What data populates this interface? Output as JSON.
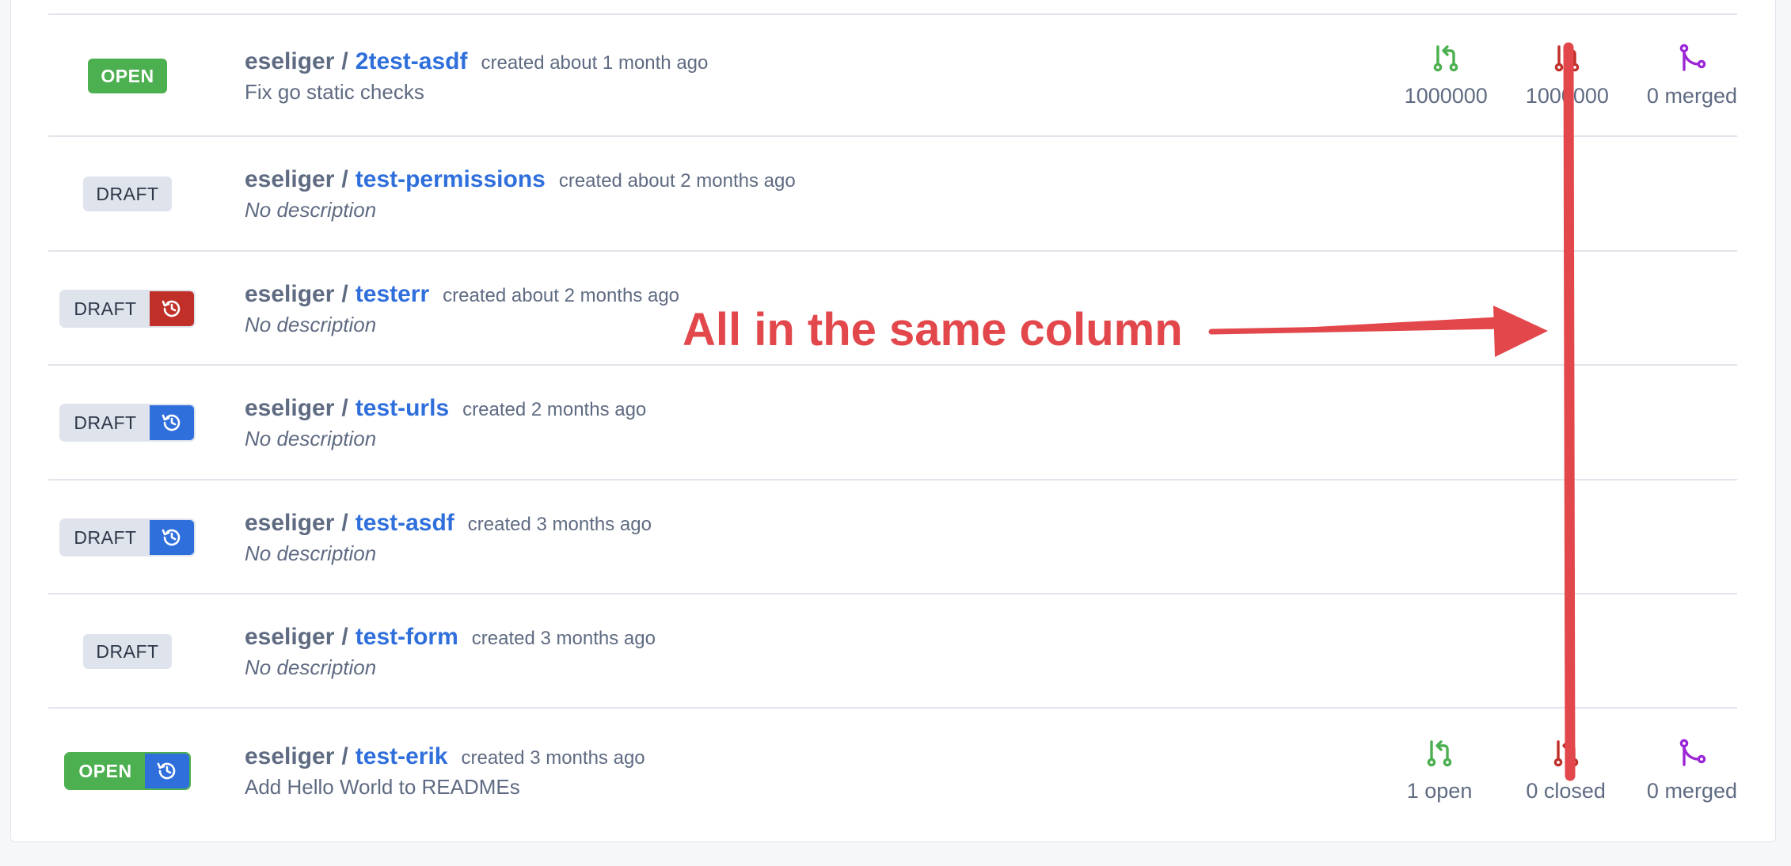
{
  "rows": [
    {
      "badge": "OPEN",
      "owner": "eseliger",
      "name": "2test-asdf",
      "created": "created about 1 month ago",
      "description": "Fix go static checks",
      "stats": {
        "open": "1000000",
        "closed": "1000000",
        "merged": "0 merged"
      }
    },
    {
      "badge": "DRAFT",
      "owner": "eseliger",
      "name": "test-permissions",
      "created": "created about 2 months ago",
      "description": "No description"
    },
    {
      "badge": "DRAFT",
      "owner": "eseliger",
      "name": "testerr",
      "created": "created about 2 months ago",
      "description": "No description"
    },
    {
      "badge": "DRAFT",
      "owner": "eseliger",
      "name": "test-urls",
      "created": "created 2 months ago",
      "description": "No description"
    },
    {
      "badge": "DRAFT",
      "owner": "eseliger",
      "name": "test-asdf",
      "created": "created 3 months ago",
      "description": "No description"
    },
    {
      "badge": "DRAFT",
      "owner": "eseliger",
      "name": "test-form",
      "created": "created 3 months ago",
      "description": "No description"
    },
    {
      "badge": "OPEN",
      "owner": "eseliger",
      "name": "test-erik",
      "created": "created 3 months ago",
      "description": "Add Hello World to READMEs",
      "stats": {
        "open": "1 open",
        "closed": "0 closed",
        "merged": "0 merged"
      }
    }
  ],
  "separator": "/",
  "icons": {
    "open_pr": "git-pull-request-icon",
    "closed_pr": "git-pull-request-closed-icon",
    "merged_pr": "git-merge-icon",
    "history": "history-icon"
  },
  "colors": {
    "open_green": "#4caf50",
    "draft_gray": "#dfe3ec",
    "link_blue": "#2f6fdc",
    "closed_red": "#c03029",
    "merged_purple": "#9b27d6",
    "annotation_red": "#e2474b"
  },
  "annotation": {
    "text": "All in the same column"
  }
}
